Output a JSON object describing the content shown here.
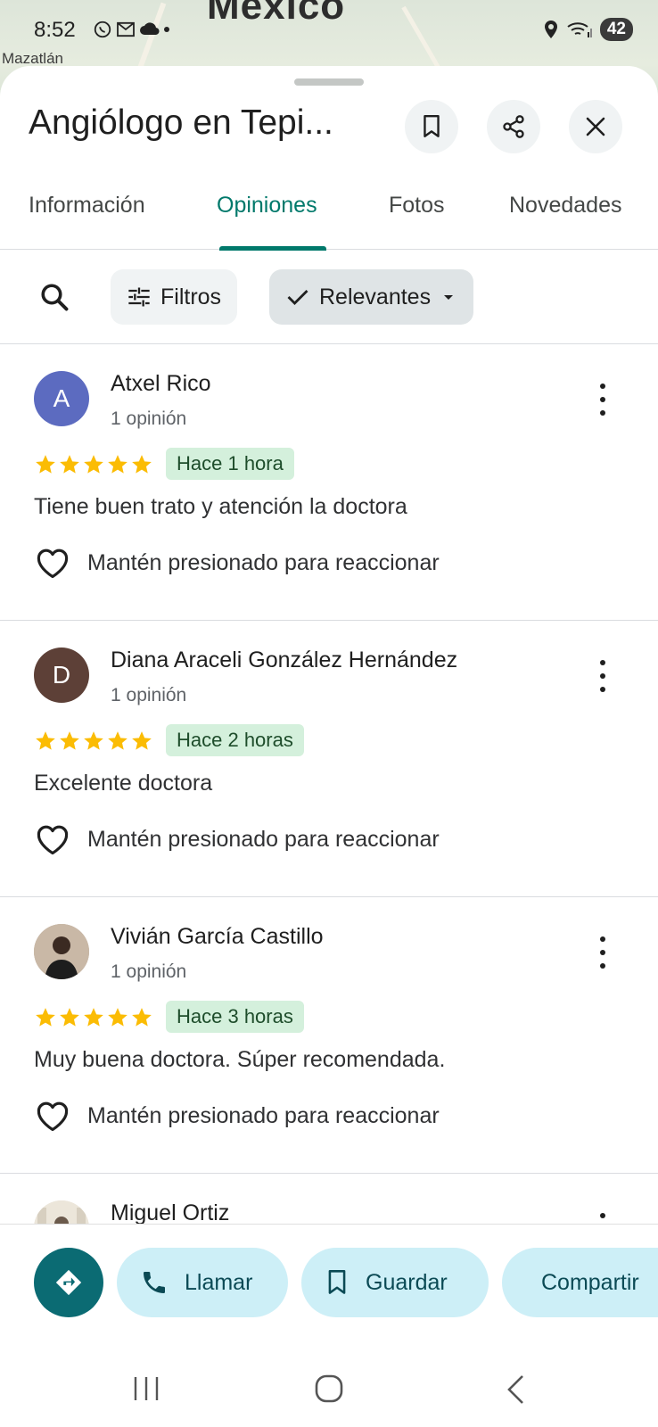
{
  "status": {
    "time": "8:52",
    "battery": "42"
  },
  "map": {
    "region_label": "Mexico",
    "city_label": "Mazatlán"
  },
  "header": {
    "title": "Angiólogo en Tepi..."
  },
  "tabs": [
    {
      "label": "Información"
    },
    {
      "label": "Opiniones"
    },
    {
      "label": "Fotos"
    },
    {
      "label": "Novedades"
    }
  ],
  "filters": {
    "filter_label": "Filtros",
    "sort_label": "Relevantes"
  },
  "reviews": [
    {
      "initial": "A",
      "avatar_color": "#5c6bc0",
      "name": "Atxel Rico",
      "count": "1 opinión",
      "rating": 5,
      "time": "Hace 1 hora",
      "text": "Tiene buen trato y atención la doctora",
      "react": "Mantén presionado para reaccionar"
    },
    {
      "initial": "D",
      "avatar_color": "#5d4037",
      "name": "Diana Araceli González Hernández",
      "count": "1 opinión",
      "rating": 5,
      "time": "Hace 2 horas",
      "text": "Excelente doctora",
      "react": "Mantén presionado para reaccionar"
    },
    {
      "initial": "",
      "avatar_color": "#b9a99a",
      "name": "Vivián García Castillo",
      "count": "1 opinión",
      "rating": 5,
      "time": "Hace 3 horas",
      "text": "Muy buena doctora. Súper recomendada.",
      "react": "Mantén presionado para reaccionar"
    },
    {
      "initial": "",
      "avatar_color": "#e8e2d6",
      "name": "Miguel Ortiz"
    }
  ],
  "actions": {
    "call": "Llamar",
    "save": "Guardar",
    "share": "Compartir"
  },
  "colors": {
    "accent": "#00796b",
    "star": "#fbbc04",
    "time_badge": "#d4f0dc",
    "action_chip": "#cdeff7",
    "directions": "#0b6b73"
  }
}
